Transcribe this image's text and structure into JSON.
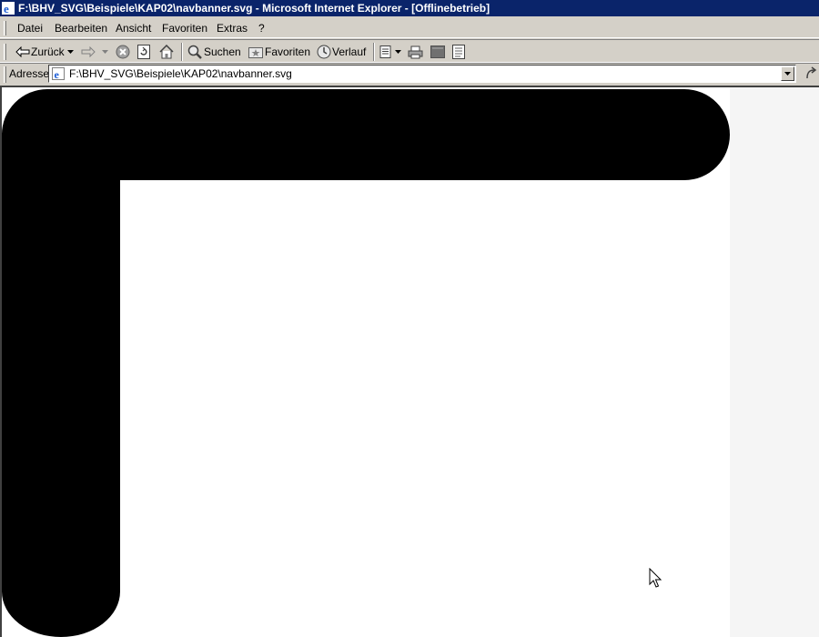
{
  "window": {
    "title": "F:\\BHV_SVG\\Beispiele\\KAP02\\navbanner.svg - Microsoft Internet Explorer - [Offlinebetrieb]"
  },
  "menu": {
    "items": [
      "Datei",
      "Bearbeiten",
      "Ansicht",
      "Favoriten",
      "Extras",
      "?"
    ]
  },
  "toolbar": {
    "back_label": "Zurück",
    "search_label": "Suchen",
    "favorites_label": "Favoriten",
    "history_label": "Verlauf"
  },
  "address": {
    "label": "Adresse",
    "value": "F:\\BHV_SVG\\Beispiele\\KAP02\\navbanner.svg"
  },
  "content": {
    "banner_color": "#000000",
    "background_color": "#ffffff"
  }
}
